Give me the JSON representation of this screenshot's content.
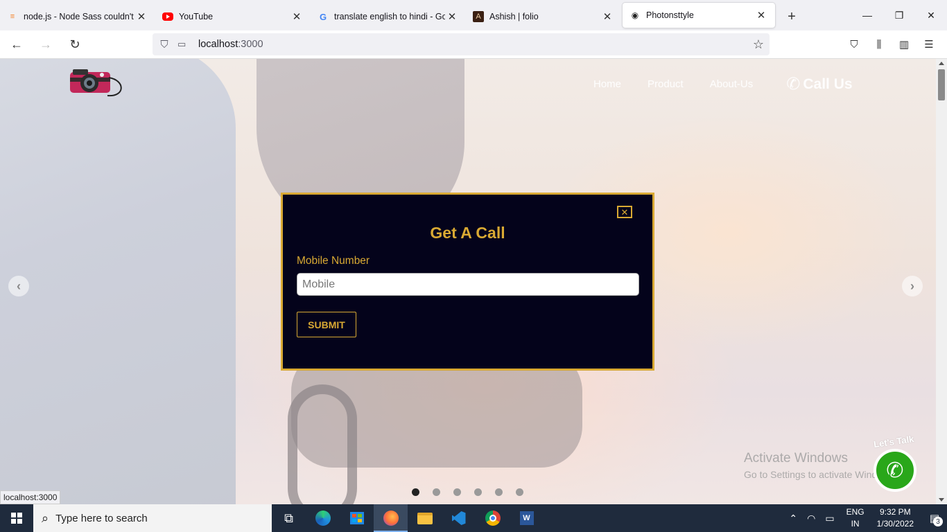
{
  "browser": {
    "tabs": [
      {
        "title": "node.js - Node Sass couldn't find",
        "favicon": "stackoverflow-icon",
        "active": false
      },
      {
        "title": "YouTube",
        "favicon": "youtube-icon",
        "active": false
      },
      {
        "title": "translate english to hindi - Goog",
        "favicon": "google-icon",
        "active": false
      },
      {
        "title": "Ashish | folio",
        "favicon": "portfolio-icon",
        "active": false
      },
      {
        "title": "Photonsttyle",
        "favicon": "camera-icon",
        "active": true
      }
    ],
    "url_host": "localhost",
    "url_port": ":3000"
  },
  "page": {
    "nav": {
      "home": "Home",
      "product": "Product",
      "about": "About-Us",
      "call_us": "Call Us"
    },
    "carousel": {
      "slide_count": 6,
      "active_index": 0
    },
    "modal": {
      "close_label": "✕",
      "title": "Get A Call",
      "mobile_label": "Mobile Number",
      "mobile_placeholder": "Mobile",
      "mobile_value": "",
      "submit_label": "SUBMIT"
    },
    "whatsapp": {
      "tagline": "Let's Talk"
    },
    "activate_windows": {
      "line1": "Activate Windows",
      "line2": "Go to Settings to activate Windows."
    },
    "status_link": "localhost:3000"
  },
  "taskbar": {
    "search_placeholder": "Type here to search",
    "lang_line1": "ENG",
    "lang_line2": "IN",
    "time": "9:32 PM",
    "date": "1/30/2022",
    "notification_count": "3"
  },
  "colors": {
    "modal_bg": "#04031b",
    "accent_gold": "#d9a933",
    "taskbar_bg": "#1f2b3d",
    "whatsapp_green": "#29a71a"
  }
}
